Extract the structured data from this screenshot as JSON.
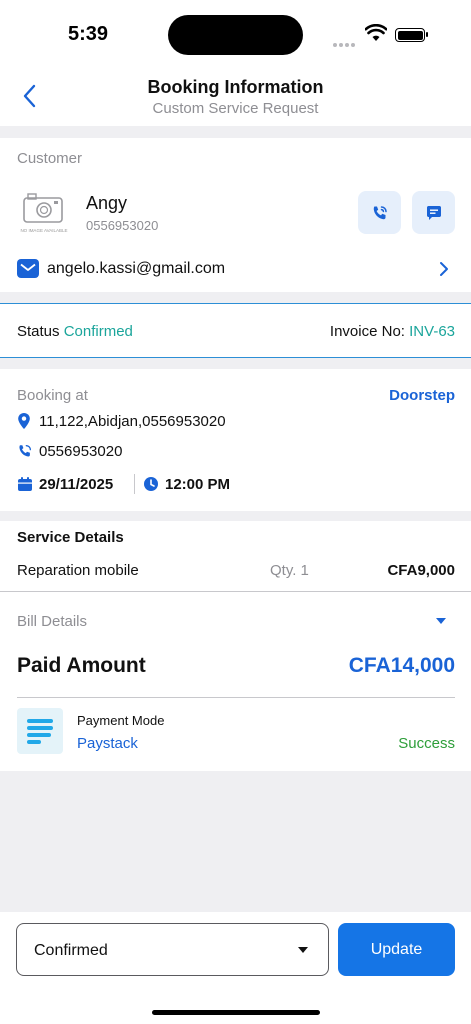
{
  "status_bar": {
    "time": "5:39"
  },
  "header": {
    "title": "Booking Information",
    "subtitle": "Custom Service Request"
  },
  "customer": {
    "section_label": "Customer",
    "no_image_text": "NO IMAGE AVAILABLE",
    "name": "Angy",
    "phone": "0556953020",
    "email": "angelo.kassi@gmail.com"
  },
  "status": {
    "label": "Status",
    "value": "Confirmed",
    "invoice_label": "Invoice No:",
    "invoice_value": "INV-63"
  },
  "booking": {
    "label": "Booking at",
    "type": "Doorstep",
    "address": "11,122,Abidjan,0556953020",
    "phone": "0556953020",
    "date": "29/11/2025",
    "time": "12:00 PM"
  },
  "service": {
    "title": "Service Details",
    "name": "Reparation mobile",
    "qty": "Qty. 1",
    "price": "CFA9,000"
  },
  "bill": {
    "label": "Bill Details",
    "paid_label": "Paid Amount",
    "paid_value": "CFA14,000",
    "payment_mode_label": "Payment Mode",
    "payment_mode_value": "Paystack",
    "payment_status": "Success"
  },
  "footer": {
    "status_select_value": "Confirmed",
    "update_label": "Update"
  },
  "colors": {
    "accent_blue": "#1a63d6",
    "teal": "#1ba59b",
    "success_green": "#2e9e3a",
    "button_blue": "#1575e6"
  }
}
